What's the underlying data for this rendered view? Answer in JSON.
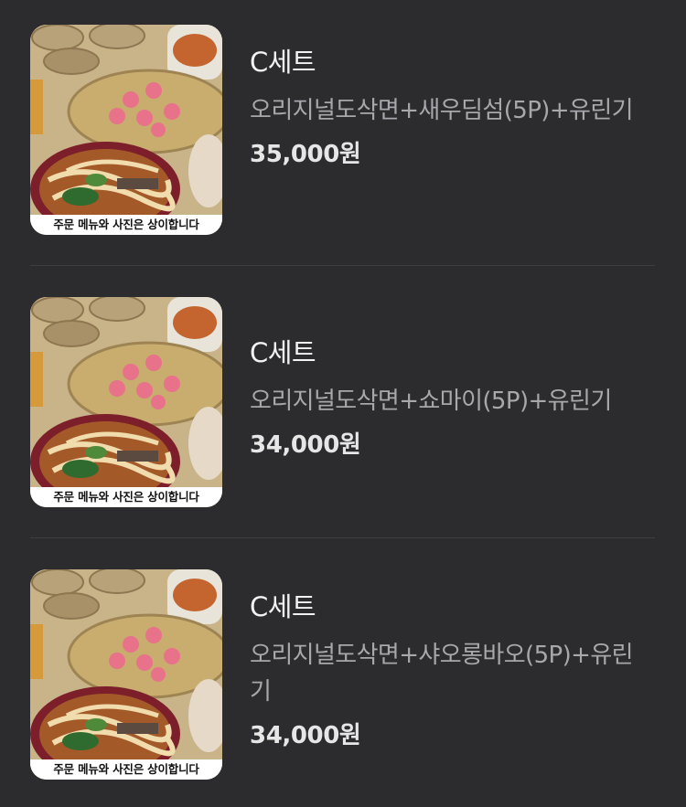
{
  "items": [
    {
      "name": "C세트",
      "description": "오리지널도삭면+새우딤섬(5P)+유린기",
      "price": "35,000원",
      "image_notice": "주문 메뉴와 사진은 상이합니다"
    },
    {
      "name": "C세트",
      "description": "오리지널도삭면+쇼마이(5P)+유린기",
      "price": "34,000원",
      "image_notice": "주문 메뉴와 사진은 상이합니다"
    },
    {
      "name": "C세트",
      "description": "오리지널도삭면+샤오롱바오(5P)+유린기",
      "price": "34,000원",
      "image_notice": "주문 메뉴와 사진은 상이합니다"
    }
  ]
}
